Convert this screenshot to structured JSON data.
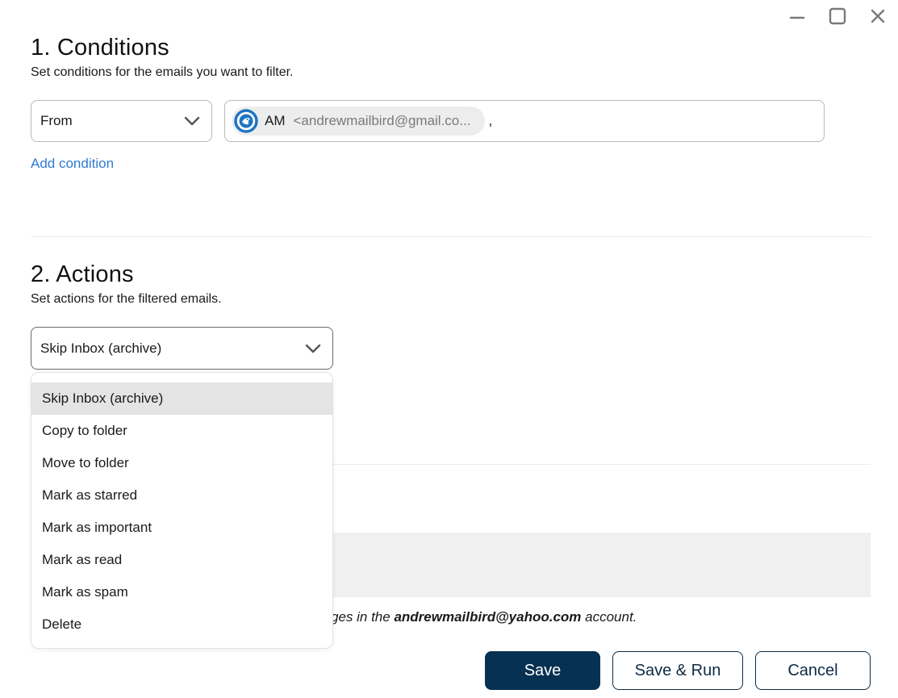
{
  "window": {
    "controls": [
      {
        "name": "minimize",
        "icon": "minimize-icon"
      },
      {
        "name": "maximize",
        "icon": "maximize-icon"
      },
      {
        "name": "close",
        "icon": "close-icon"
      }
    ]
  },
  "conditions": {
    "title": "1. Conditions",
    "subtitle": "Set conditions for the emails you want to filter.",
    "field_select": {
      "value": "From"
    },
    "recipient": {
      "initials": "AM",
      "email": "<andrewmailbird@gmail.co...",
      "separator": ",",
      "avatar_icon": "mailbird-logo-icon"
    },
    "add_condition_label": "Add condition"
  },
  "actions": {
    "title": "2. Actions",
    "subtitle": "Set actions for the filtered emails.",
    "action_select": {
      "value": "Skip Inbox (archive)"
    },
    "dropdown_options": [
      {
        "label": "Skip Inbox (archive)",
        "selected": true
      },
      {
        "label": "Copy to folder",
        "selected": false
      },
      {
        "label": "Move to folder",
        "selected": false
      },
      {
        "label": "Mark as starred",
        "selected": false
      },
      {
        "label": "Mark as important",
        "selected": false
      },
      {
        "label": "Mark as read",
        "selected": false
      },
      {
        "label": "Mark as spam",
        "selected": false
      },
      {
        "label": "Delete",
        "selected": false
      }
    ]
  },
  "account_note": {
    "prefix": "ges in the ",
    "account": "andrewmailbird@yahoo.com",
    "suffix": " account."
  },
  "footer": {
    "save_label": "Save",
    "save_run_label": "Save & Run",
    "cancel_label": "Cancel"
  },
  "colors": {
    "primary": "#073152",
    "link": "#2e7bd1",
    "selected_option_bg": "#e4e4e4"
  }
}
